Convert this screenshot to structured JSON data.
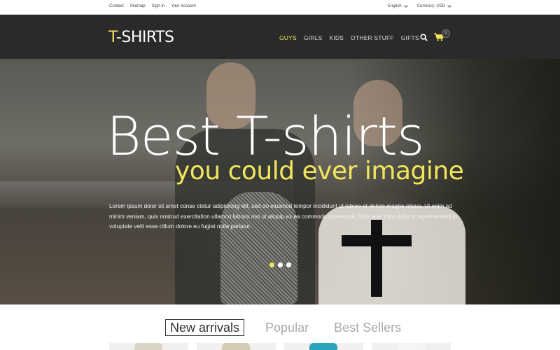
{
  "topbar": {
    "links": [
      "Contact",
      "Sitemap",
      "Sign In",
      "Your Account"
    ],
    "language": "English",
    "currency_label": "Currency: USD"
  },
  "header": {
    "logo_accent": "T",
    "logo_rest": "-SHIRTS",
    "nav": [
      "GUYS",
      "GIRLS",
      "KIDS",
      "OTHER STUFF",
      "GIFTS"
    ],
    "active_nav": "GUYS",
    "cart_count": "0",
    "icons": [
      "search-icon",
      "cart-icon"
    ]
  },
  "hero": {
    "title": "Best T-shirts",
    "subtitle": "you could ever imagine",
    "text": "Lorem ipsum dolor sit amet conse ctetur adipisicing elit, sed do eiusmod tempor incididunt ut labore et dolore magna aliqua. Ut enim ad minim veniam, quis nostrud exercitation ullamco laboris nisi ut aliquip ex ea commodo consequat. Duis aute irure dolor in reprehenderit in voluptate velit esse cillum dolore eu fugiat nulla pariatur.",
    "slide_count": 3,
    "active_slide": 1
  },
  "tabs": {
    "items": [
      "New arrivals",
      "Popular",
      "Best Sellers"
    ],
    "active": "New arrivals"
  },
  "colors": {
    "accent": "#f2e65a",
    "header_bg": "#2a2a2a"
  },
  "products": {
    "tee_colors": [
      "#d9d4c4",
      "#d6cbb5",
      "#2aa3b8",
      "#f5f5f5"
    ]
  }
}
